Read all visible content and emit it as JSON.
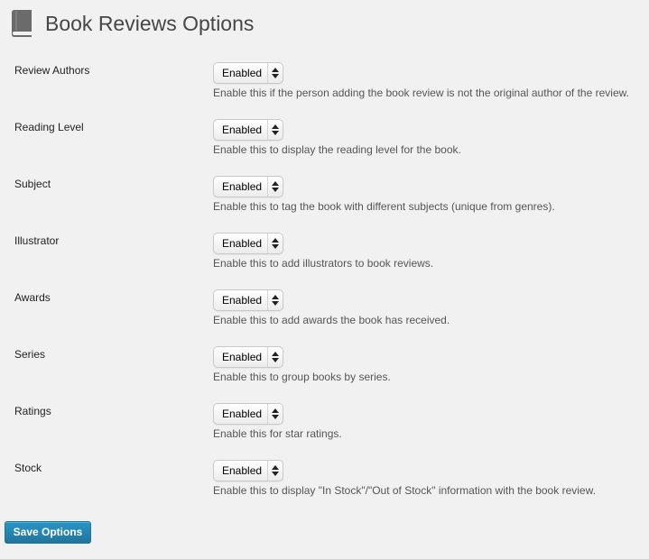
{
  "header": {
    "title": "Book Reviews Options",
    "icon": "book-icon"
  },
  "options": [
    {
      "key": "review-authors",
      "label": "Review Authors",
      "value": "Enabled",
      "description": "Enable this if the person adding the book review is not the original author of the review."
    },
    {
      "key": "reading-level",
      "label": "Reading Level",
      "value": "Enabled",
      "description": "Enable this to display the reading level for the book."
    },
    {
      "key": "subject",
      "label": "Subject",
      "value": "Enabled",
      "description": "Enable this to tag the book with different subjects (unique from genres)."
    },
    {
      "key": "illustrator",
      "label": "Illustrator",
      "value": "Enabled",
      "description": "Enable this to add illustrators to book reviews."
    },
    {
      "key": "awards",
      "label": "Awards",
      "value": "Enabled",
      "description": "Enable this to add awards the book has received."
    },
    {
      "key": "series",
      "label": "Series",
      "value": "Enabled",
      "description": "Enable this to group books by series."
    },
    {
      "key": "ratings",
      "label": "Ratings",
      "value": "Enabled",
      "description": "Enable this for star ratings."
    },
    {
      "key": "stock",
      "label": "Stock",
      "value": "Enabled",
      "description": "Enable this to display \"In Stock\"/\"Out of Stock\" information with the book review."
    }
  ],
  "actions": {
    "save_label": "Save Options"
  },
  "colors": {
    "background": "#f1f1f1",
    "primary_button": "#21759b",
    "title": "#464646"
  }
}
